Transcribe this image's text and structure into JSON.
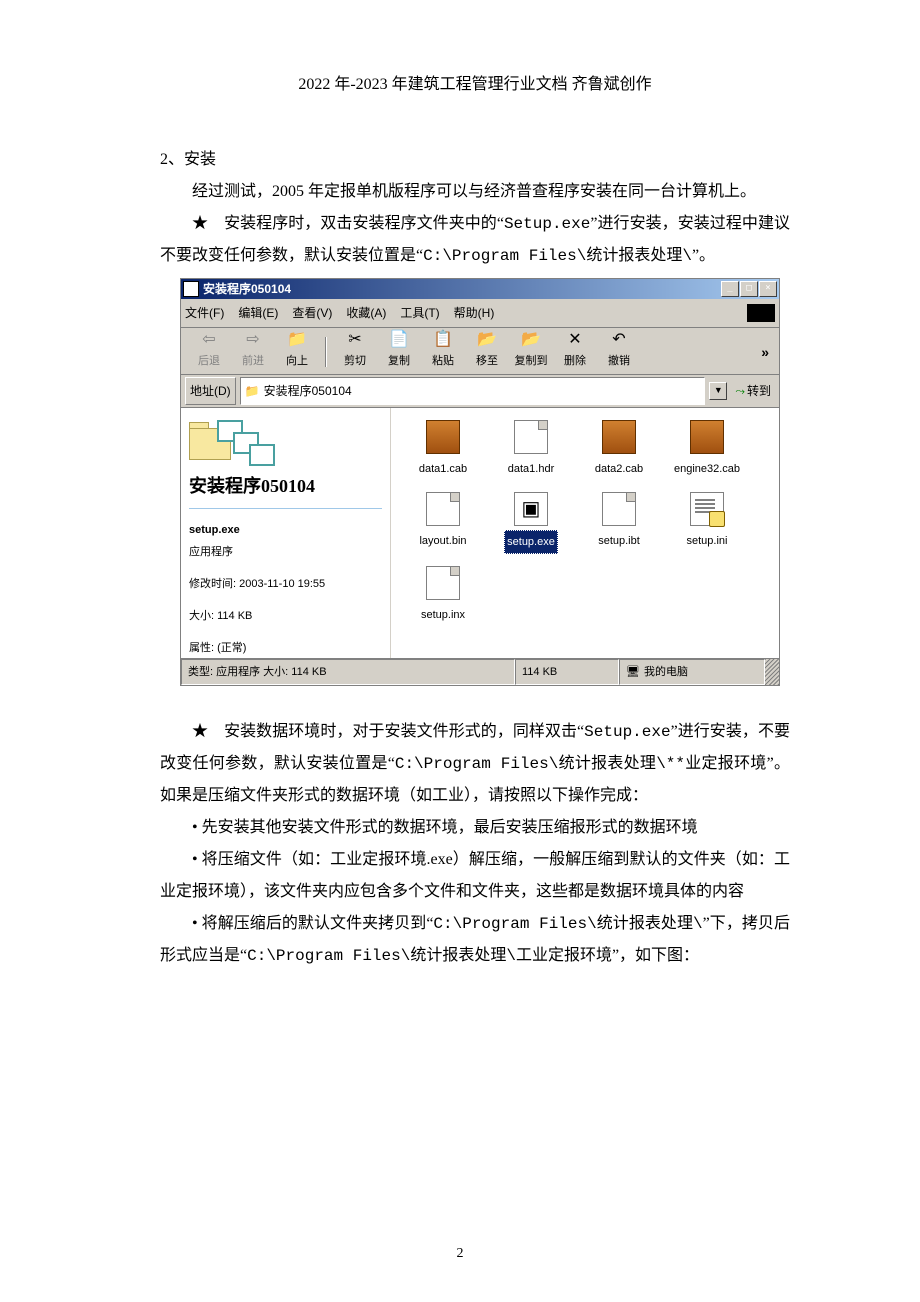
{
  "header": "2022 年-2023 年建筑工程管理行业文档 齐鲁斌创作",
  "section_title": "2、安装",
  "para1": "经过测试，2005 年定报单机版程序可以与经济普查程序安装在同一台计算机上。",
  "para2a": "★　安装程序时，双击安装程序文件夹中的“",
  "para2b": "Setup.exe",
  "para2c": "”进行安装，安装过程中建议不要改变任何参数，默认安装位置是“",
  "para2d": "C:\\Program Files\\统计报表处理\\",
  "para2e": "”。",
  "para3a": "★　安装数据环境时，对于安装文件形式的，同样双击“",
  "para3b": "Setup.exe",
  "para3c": "”进行安装，不要改变任何参数，默认安装位置是“",
  "para3d": "C:\\Program Files\\统计报表处理\\**业定报环境",
  "para3e": "”。如果是压缩文件夹形式的数据环境（如工业），请按照以下操作完成：",
  "bullet1": "• 先安装其他安装文件形式的数据环境，最后安装压缩报形式的数据环境",
  "bullet2a": "• 将压缩文件（如：工业定报环境.exe）解压缩，一般解压缩到默认的文件夹（如：工业定报环境），该文件夹内应包含多个文件和文件夹，这些都是数据环境具体的内容",
  "bullet3a": "• 将解压缩后的默认文件夹拷贝到“",
  "bullet3b": "C:\\Program Files\\统计报表处理\\",
  "bullet3c": "”下，拷贝后形式应当是“",
  "bullet3d": "C:\\Program Files\\统计报表处理\\工业定报环境",
  "bullet3e": "”，如下图：",
  "page_number": "2",
  "win": {
    "title": "安装程序050104",
    "menus": {
      "file": "文件(F)",
      "edit": "编辑(E)",
      "view": "查看(V)",
      "fav": "收藏(A)",
      "tools": "工具(T)",
      "help": "帮助(H)"
    },
    "tb": {
      "back": "后退",
      "fwd": "前进",
      "up": "向上",
      "cut": "剪切",
      "copy": "复制",
      "paste": "粘贴",
      "move": "移至",
      "copyto": "复制到",
      "delete": "删除",
      "undo": "撤销"
    },
    "addr_label": "地址(D)",
    "addr_value": "安装程序050104",
    "go": "转到",
    "left": {
      "title": "安装程序050104",
      "file_name": "setup.exe",
      "file_type": "应用程序",
      "mod_label": "修改时间: 2003-11-10 19:55",
      "size_label": "大小: 114 KB",
      "attr_label": "属性: (正常)"
    },
    "files": {
      "f1": "data1.cab",
      "f2": "data1.hdr",
      "f3": "data2.cab",
      "f4": "engine32.cab",
      "f5": "layout.bin",
      "f6": "setup.exe",
      "f7": "setup.ibt",
      "f8": "setup.ini",
      "f9": "setup.inx"
    },
    "status": {
      "s1": "类型: 应用程序 大小: 114 KB",
      "s2": "114 KB",
      "s3": "我的电脑"
    }
  }
}
